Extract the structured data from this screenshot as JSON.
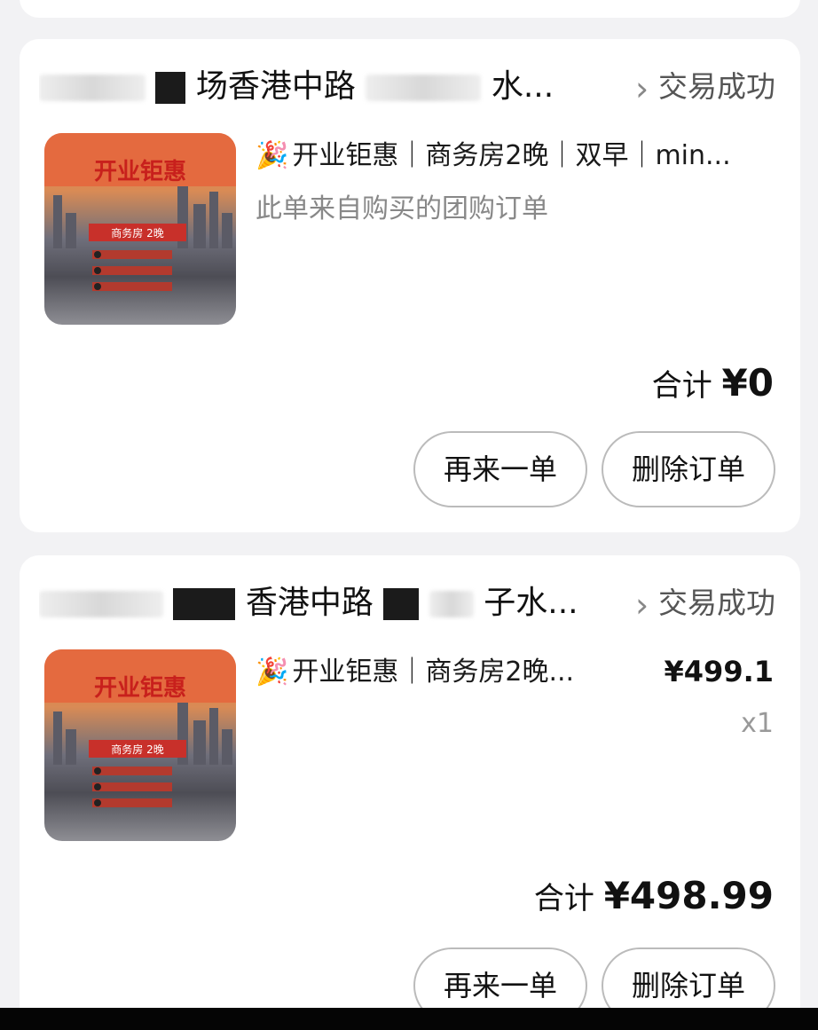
{
  "orders": [
    {
      "store_visible": "场香港中路",
      "store_tail": "水...",
      "status": "交易成功",
      "product_title": "开业钜惠｜商务房2晚｜双早｜min...",
      "note": "此单来自购买的团购订单",
      "total_label": "合计",
      "total_value": "¥0",
      "btn_again": "再来一单",
      "btn_delete": "删除订单"
    },
    {
      "store_visible": "香港中路",
      "store_tail": "子水...",
      "status": "交易成功",
      "product_title": "开业钜惠｜商务房2晚...",
      "unit_price": "¥499.1",
      "quantity": "x1",
      "total_label": "合计",
      "total_value": "¥498.99",
      "btn_again": "再来一单",
      "btn_delete": "删除订单"
    }
  ],
  "thumbnail": {
    "headline": "开业钜惠",
    "room_label": "商务房 2晚"
  },
  "icons": {
    "chevron": "chevron-right-icon",
    "party": "party-popper-icon"
  },
  "colors": {
    "page_bg": "#f2f2f4",
    "card_bg": "#ffffff",
    "thumb_orange": "#e56a40"
  }
}
